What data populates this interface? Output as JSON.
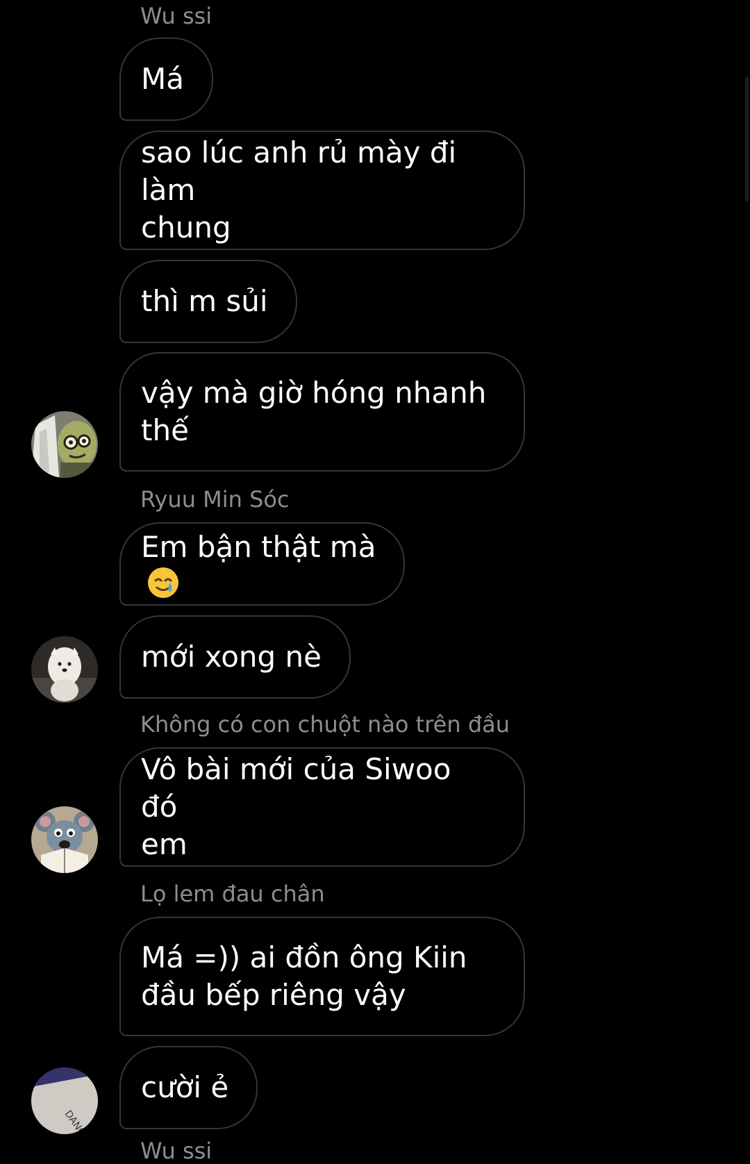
{
  "messages": [
    {
      "sender": "Wu ssi",
      "lines": [
        "Má"
      ]
    },
    {
      "lines": [
        "sao lúc anh rủ mày đi làm",
        "chung"
      ]
    },
    {
      "lines": [
        "thì m sủi"
      ]
    },
    {
      "lines": [
        "vậy mà giờ hóng nhanh",
        "thế"
      ]
    },
    {
      "sender": "Ryuu Min Sóc",
      "lines": [
        "Em bận thật mà"
      ],
      "emoji": "🥲"
    },
    {
      "lines": [
        "mới xong nè"
      ]
    },
    {
      "sender": "Không có con chuột nào trên đầu",
      "lines": [
        "Vô bài mới của Siwoo đó",
        "em"
      ]
    },
    {
      "sender": "Lọ lem đau chân",
      "lines": [
        "Má =)) ai đồn ông Kiin",
        "đầu bếp riêng vậy"
      ]
    },
    {
      "lines": [
        "cười ẻ"
      ]
    }
  ],
  "avatars": {
    "wu_ssi": {
      "icon": "frog-mask-avatar"
    },
    "ryuu_min_soc": {
      "icon": "white-dog-avatar"
    },
    "khong_co_con_chuot": {
      "icon": "rat-reading-avatar"
    },
    "lo_lem": {
      "icon": "dance-paper-avatar",
      "text": "DANCE"
    }
  },
  "next_sender": "Wu ssi",
  "colors": {
    "background": "#000000",
    "bubble_border": "#363636",
    "sender_name": "#8e8e8e",
    "text": "#ffffff"
  }
}
